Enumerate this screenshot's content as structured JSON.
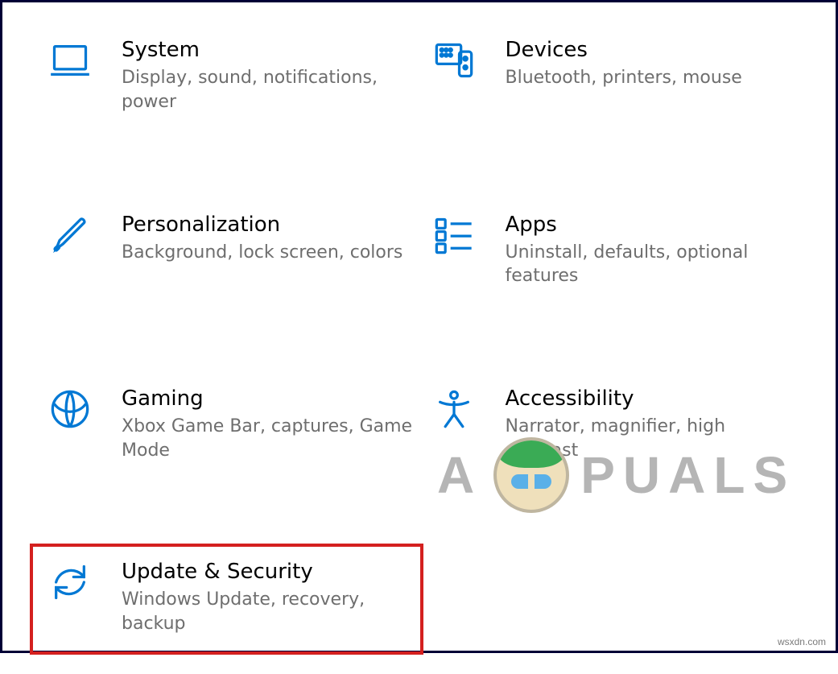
{
  "items": [
    {
      "id": "system",
      "title": "System",
      "desc": "Display, sound, notifications, power"
    },
    {
      "id": "devices",
      "title": "Devices",
      "desc": "Bluetooth, printers, mouse"
    },
    {
      "id": "personalization",
      "title": "Personalization",
      "desc": "Background, lock screen, colors"
    },
    {
      "id": "apps",
      "title": "Apps",
      "desc": "Uninstall, defaults, optional features"
    },
    {
      "id": "gaming",
      "title": "Gaming",
      "desc": "Xbox Game Bar, captures, Game Mode"
    },
    {
      "id": "accessibility",
      "title": "Accessibility",
      "desc": "Narrator, magnifier, high contrast"
    },
    {
      "id": "update-security",
      "title": "Update & Security",
      "desc": "Windows Update, recovery, backup"
    }
  ],
  "highlighted": "update-security",
  "watermark": {
    "left": "A",
    "right": "PUALS"
  },
  "attribution": "wsxdn.com",
  "colors": {
    "accent": "#0078d4",
    "highlight": "#d4201f",
    "muted": "#6e6e6e"
  }
}
